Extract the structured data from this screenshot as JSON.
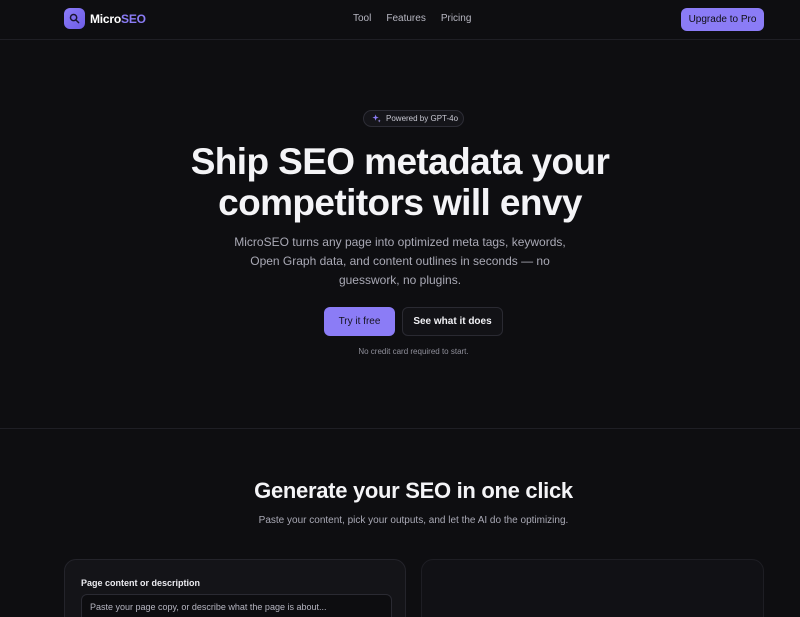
{
  "nav": {
    "brand_main": "Micro",
    "brand_accent": "SEO",
    "links": [
      "Tool",
      "Features",
      "Pricing"
    ],
    "cta": "Upgrade to Pro"
  },
  "hero": {
    "badge": "Powered by GPT-4o",
    "title_line1": "Ship SEO metadata your",
    "title_line2": "competitors will envy",
    "subtitle": "MicroSEO turns any page into optimized meta tags, keywords, Open Graph data, and content outlines in seconds — no guesswork, no plugins.",
    "primary_button": "Try it free",
    "secondary_button": "See what it does",
    "note": "No credit card required to start."
  },
  "generator": {
    "title": "Generate your SEO in one click",
    "subtitle": "Paste your content, pick your outputs, and let the AI do the optimizing.",
    "content_label": "Page content or description",
    "content_placeholder": "Paste your page copy, or describe what the page is about..."
  },
  "colors": {
    "accent": "#8b7cf6",
    "background": "#0e0e11"
  },
  "icons": {
    "logo": "search-icon",
    "badge": "sparkles-icon"
  }
}
